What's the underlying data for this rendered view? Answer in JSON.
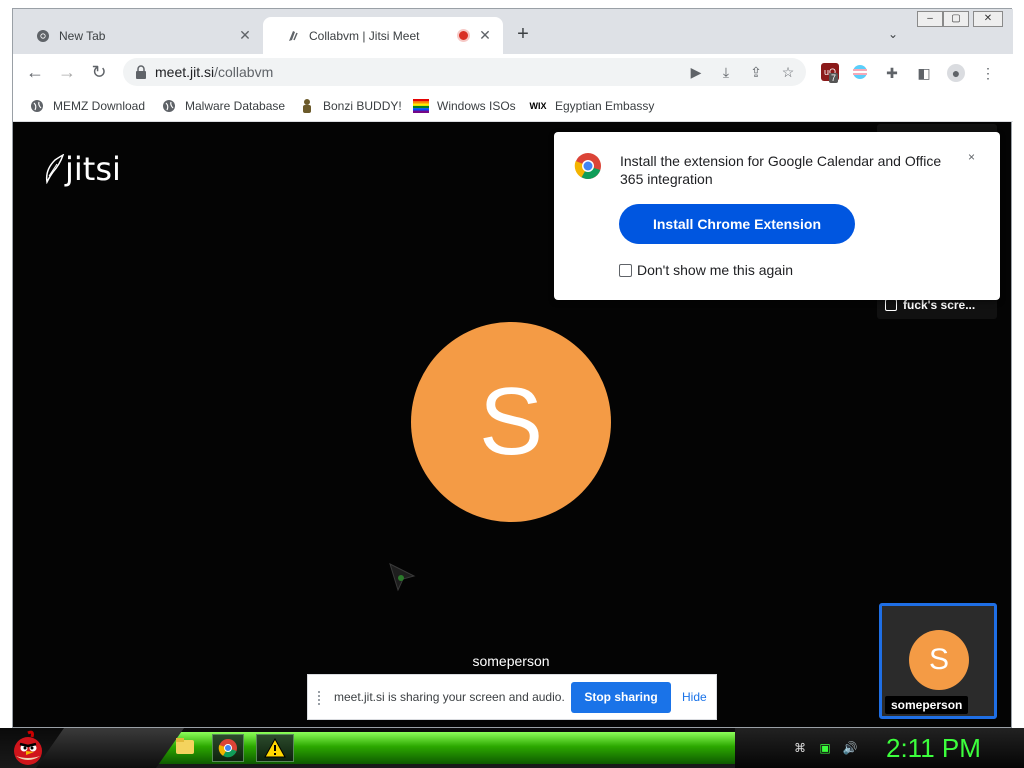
{
  "browser": {
    "tabs": [
      {
        "title": "New Tab",
        "active": false
      },
      {
        "title": "Collabvm | Jitsi Meet",
        "active": true,
        "recording": true
      }
    ],
    "url_host": "meet.jit.si",
    "url_path": "/collabvm",
    "extension_badge": "7"
  },
  "bookmarks": [
    {
      "label": "MEMZ Download",
      "icon": "globe-icon"
    },
    {
      "label": "Malware Database",
      "icon": "globe-icon"
    },
    {
      "label": "Bonzi BUDDY!",
      "icon": "bonzi-icon"
    },
    {
      "label": "Windows ISOs",
      "icon": "rainbow-flag-icon"
    },
    {
      "label": "Egyptian Embassy",
      "icon": "wix-icon"
    }
  ],
  "jitsi": {
    "logo_text": "jitsi",
    "main_avatar_letter": "S",
    "main_participant_name": "someperson",
    "remote_label": "fuck's scre...",
    "self_avatar_letter": "S",
    "self_name": "someperson",
    "avatar_color": "#f49b45"
  },
  "extension_popup": {
    "message": "Install the extension for Google Calendar and Office 365 integration",
    "close": "×",
    "install_button": "Install Chrome Extension",
    "dont_show": "Don't show me this again"
  },
  "share_bar": {
    "message": "meet.jit.si is sharing your screen and audio.",
    "stop_button": "Stop sharing",
    "hide": "Hide"
  },
  "taskbar": {
    "clock": "2:11 PM"
  }
}
